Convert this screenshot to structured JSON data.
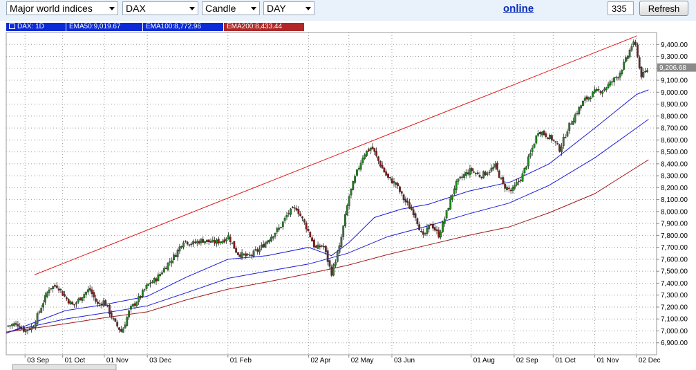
{
  "toolbar": {
    "market_select": "Major world indices",
    "symbol_select": "DAX",
    "chart_type_select": "Candle",
    "period_select": "DAY",
    "status_link": "online",
    "bars_input": "335",
    "refresh_label": "Refresh"
  },
  "legend": {
    "symbol": "DAX: 1D",
    "ema50": "EMA50:9,019.67",
    "ema100": "EMA100:8,772.96",
    "ema200": "EMA200:8,433.44"
  },
  "colors": {
    "toolbar_bg": "#e9f1fb",
    "legend_blue": "#0b2bd6",
    "legend_red": "#b02828",
    "candle_up": "#1f8a1f",
    "candle_down": "#8b1a1a",
    "ema_blue": "#1a1ad8",
    "ema_red": "#a01818",
    "trendline": "#e01818"
  },
  "chart_data": {
    "type": "candlestick",
    "ylim": [
      6800,
      9500
    ],
    "yticks": [
      "6,900.00",
      "7,000.00",
      "7,100.00",
      "7,200.00",
      "7,300.00",
      "7,400.00",
      "7,500.00",
      "7,600.00",
      "7,700.00",
      "7,800.00",
      "7,900.00",
      "8,000.00",
      "8,100.00",
      "8,200.00",
      "8,300.00",
      "8,400.00",
      "8,500.00",
      "8,600.00",
      "8,700.00",
      "8,800.00",
      "8,900.00",
      "9,000.00",
      "9,100.00",
      "9,200.00",
      "9,300.00",
      "9,400.00"
    ],
    "ytick_values": [
      6900,
      7000,
      7100,
      7200,
      7300,
      7400,
      7500,
      7600,
      7700,
      7800,
      7900,
      8000,
      8100,
      8200,
      8300,
      8400,
      8500,
      8600,
      8700,
      8800,
      8900,
      9000,
      9100,
      9200,
      9300,
      9400
    ],
    "xticks": [
      {
        "label": "03 Sep",
        "day": 0
      },
      {
        "label": "01 Oct",
        "day": 28
      },
      {
        "label": "01 Nov",
        "day": 59
      },
      {
        "label": "03 Dec",
        "day": 91
      },
      {
        "label": "01 Feb",
        "day": 151
      },
      {
        "label": "02 Apr",
        "day": 211
      },
      {
        "label": "02 May",
        "day": 241
      },
      {
        "label": "03 Jun",
        "day": 273
      },
      {
        "label": "01 Aug",
        "day": 332
      },
      {
        "label": "02 Sep",
        "day": 364
      },
      {
        "label": "01 Oct",
        "day": 393
      },
      {
        "label": "01 Nov",
        "day": 424
      },
      {
        "label": "02 Dec",
        "day": 455
      }
    ],
    "xlim": [
      -14,
      470
    ],
    "last_price": "9,206.68",
    "last_value": 9206.68,
    "close_path": [
      [
        -14,
        7040
      ],
      [
        -6,
        7060
      ],
      [
        0,
        7000
      ],
      [
        6,
        7040
      ],
      [
        12,
        7200
      ],
      [
        18,
        7360
      ],
      [
        24,
        7380
      ],
      [
        30,
        7280
      ],
      [
        36,
        7210
      ],
      [
        42,
        7290
      ],
      [
        48,
        7350
      ],
      [
        54,
        7220
      ],
      [
        59,
        7250
      ],
      [
        66,
        7080
      ],
      [
        72,
        6990
      ],
      [
        78,
        7180
      ],
      [
        84,
        7260
      ],
      [
        91,
        7380
      ],
      [
        98,
        7440
      ],
      [
        106,
        7560
      ],
      [
        112,
        7640
      ],
      [
        118,
        7760
      ],
      [
        124,
        7730
      ],
      [
        132,
        7760
      ],
      [
        140,
        7740
      ],
      [
        148,
        7760
      ],
      [
        151,
        7800
      ],
      [
        158,
        7650
      ],
      [
        166,
        7620
      ],
      [
        174,
        7680
      ],
      [
        182,
        7780
      ],
      [
        190,
        7870
      ],
      [
        196,
        7990
      ],
      [
        202,
        8030
      ],
      [
        208,
        7900
      ],
      [
        211,
        7830
      ],
      [
        216,
        7690
      ],
      [
        222,
        7720
      ],
      [
        228,
        7480
      ],
      [
        234,
        7700
      ],
      [
        241,
        8120
      ],
      [
        246,
        8300
      ],
      [
        252,
        8480
      ],
      [
        258,
        8540
      ],
      [
        264,
        8400
      ],
      [
        270,
        8280
      ],
      [
        276,
        8230
      ],
      [
        282,
        8100
      ],
      [
        290,
        7980
      ],
      [
        296,
        7780
      ],
      [
        302,
        7900
      ],
      [
        308,
        7800
      ],
      [
        314,
        8000
      ],
      [
        320,
        8220
      ],
      [
        326,
        8300
      ],
      [
        332,
        8350
      ],
      [
        338,
        8300
      ],
      [
        344,
        8330
      ],
      [
        350,
        8380
      ],
      [
        356,
        8220
      ],
      [
        362,
        8170
      ],
      [
        364,
        8200
      ],
      [
        370,
        8300
      ],
      [
        376,
        8480
      ],
      [
        382,
        8680
      ],
      [
        388,
        8640
      ],
      [
        393,
        8600
      ],
      [
        398,
        8520
      ],
      [
        404,
        8700
      ],
      [
        410,
        8820
      ],
      [
        416,
        8930
      ],
      [
        424,
        9000
      ],
      [
        430,
        9020
      ],
      [
        436,
        9080
      ],
      [
        442,
        9150
      ],
      [
        448,
        9290
      ],
      [
        452,
        9410
      ],
      [
        455,
        9380
      ],
      [
        458,
        9140
      ],
      [
        461,
        9150
      ],
      [
        464,
        9206.68
      ]
    ],
    "ema_series": [
      {
        "color": "#1a1ad8",
        "points": [
          [
            -14,
            6980
          ],
          [
            30,
            7170
          ],
          [
            59,
            7220
          ],
          [
            91,
            7290
          ],
          [
            120,
            7450
          ],
          [
            151,
            7600
          ],
          [
            180,
            7630
          ],
          [
            211,
            7700
          ],
          [
            228,
            7630
          ],
          [
            241,
            7740
          ],
          [
            260,
            7950
          ],
          [
            280,
            8020
          ],
          [
            300,
            8060
          ],
          [
            330,
            8170
          ],
          [
            362,
            8250
          ],
          [
            390,
            8400
          ],
          [
            424,
            8700
          ],
          [
            455,
            8980
          ],
          [
            464,
            9019.67
          ]
        ]
      },
      {
        "color": "#1a1ad8",
        "points": [
          [
            -14,
            6990
          ],
          [
            30,
            7100
          ],
          [
            59,
            7150
          ],
          [
            91,
            7210
          ],
          [
            120,
            7320
          ],
          [
            151,
            7440
          ],
          [
            180,
            7500
          ],
          [
            211,
            7560
          ],
          [
            240,
            7650
          ],
          [
            270,
            7790
          ],
          [
            300,
            7880
          ],
          [
            330,
            7980
          ],
          [
            360,
            8070
          ],
          [
            390,
            8220
          ],
          [
            424,
            8450
          ],
          [
            455,
            8700
          ],
          [
            464,
            8772.96
          ]
        ]
      },
      {
        "color": "#a01818",
        "points": [
          [
            -14,
            6990
          ],
          [
            30,
            7060
          ],
          [
            59,
            7110
          ],
          [
            91,
            7160
          ],
          [
            120,
            7260
          ],
          [
            151,
            7350
          ],
          [
            180,
            7410
          ],
          [
            211,
            7480
          ],
          [
            240,
            7550
          ],
          [
            270,
            7640
          ],
          [
            300,
            7720
          ],
          [
            330,
            7800
          ],
          [
            360,
            7870
          ],
          [
            390,
            7990
          ],
          [
            424,
            8150
          ],
          [
            455,
            8370
          ],
          [
            464,
            8433.44
          ]
        ]
      }
    ],
    "trendline": [
      [
        7,
        7470
      ],
      [
        455,
        9470
      ]
    ]
  }
}
